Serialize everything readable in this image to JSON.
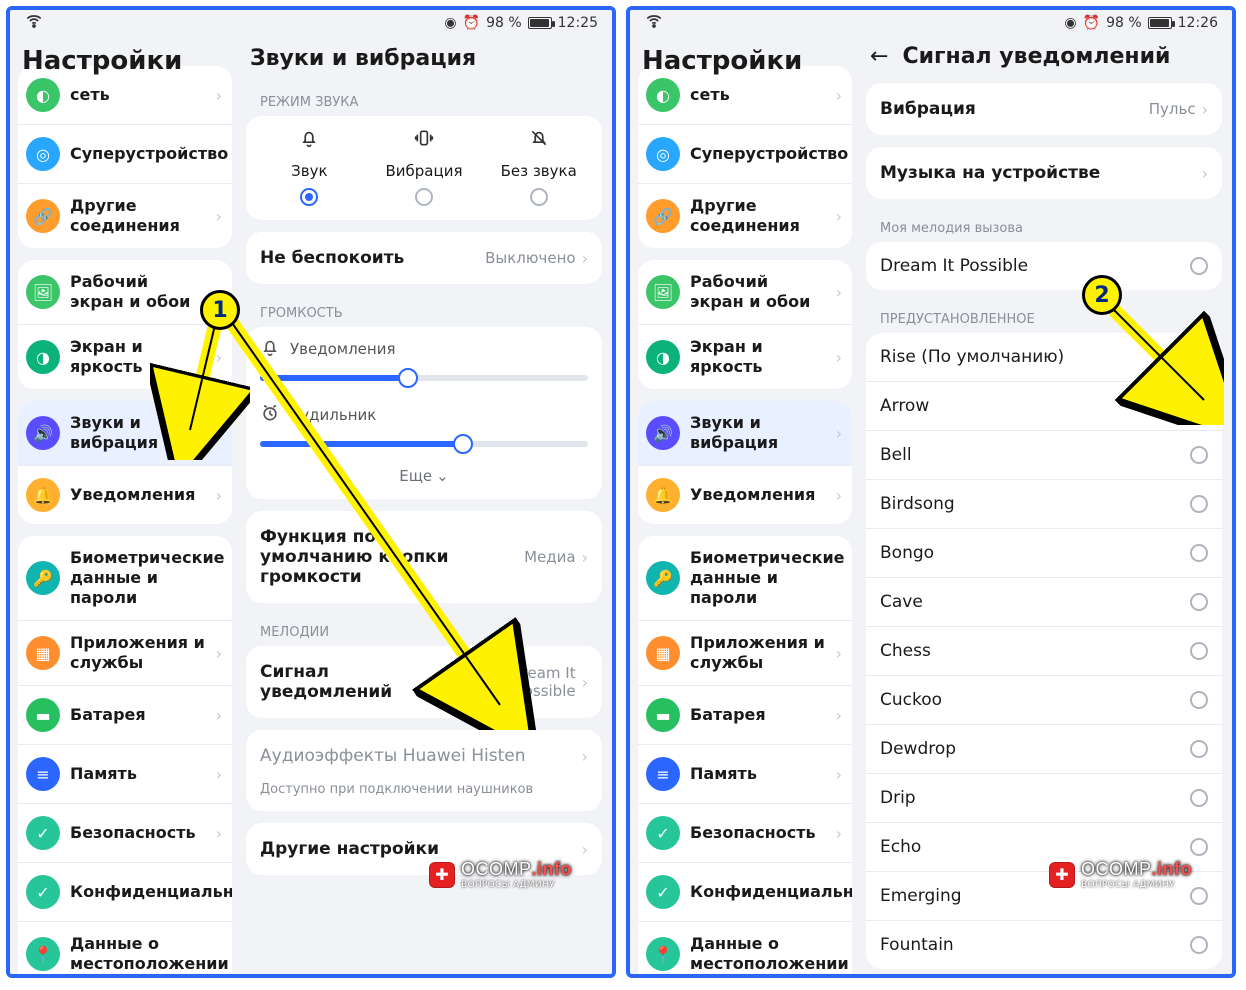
{
  "status": {
    "battery_pct": "98 %",
    "time_left": "12:25",
    "time_right": "12:26"
  },
  "sidebar": {
    "title": "Настройки",
    "groups": [
      [
        {
          "label": "сеть",
          "color": "#3ac569"
        },
        {
          "label": "Суперустройство",
          "color": "#29a7ff"
        },
        {
          "label": "Другие соединения",
          "color": "#ff9c2b"
        }
      ],
      [
        {
          "label": "Рабочий экран и обои",
          "color": "#3ac569"
        },
        {
          "label": "Экран и яркость",
          "color": "#0bb37a"
        }
      ],
      [
        {
          "label": "Звуки и вибрация",
          "color": "#5a4dff",
          "selected": true
        },
        {
          "label": "Уведомления",
          "color": "#ffb02e"
        }
      ],
      [
        {
          "label": "Биометрические данные и пароли",
          "color": "#11b5b0"
        },
        {
          "label": "Приложения и службы",
          "color": "#ff8f2e"
        },
        {
          "label": "Батарея",
          "color": "#27c060"
        },
        {
          "label": "Память",
          "color": "#2a66ff"
        },
        {
          "label": "Безопасность",
          "color": "#26c59a"
        },
        {
          "label": "Конфиденциальность",
          "color": "#26c59a"
        },
        {
          "label": "Данные о местоположении",
          "color": "#26c59a"
        }
      ]
    ]
  },
  "left": {
    "title": "Звуки и вибрация",
    "mode_label": "РЕЖИМ ЗВУКА",
    "modes": [
      {
        "label": "Звук",
        "glyph": "bell",
        "selected": true
      },
      {
        "label": "Вибрация",
        "glyph": "vibrate",
        "selected": false
      },
      {
        "label": "Без звука",
        "glyph": "bell-off",
        "selected": false
      }
    ],
    "dnd": {
      "title": "Не беспокоить",
      "value": "Выключено"
    },
    "volume_label": "ГРОМКОСТЬ",
    "sliders": [
      {
        "icon": "bell",
        "label": "Уведомления",
        "pct": 45
      },
      {
        "icon": "alarm",
        "label": "Будильник",
        "pct": 62
      }
    ],
    "more": "Еще",
    "vol_btn": {
      "title": "Функция по умолчанию кнопки громкости",
      "value": "Медиа"
    },
    "melodies_label": "МЕЛОДИИ",
    "notif": {
      "title": "Сигнал уведомлений",
      "value": "Dream It Possible"
    },
    "histen": {
      "title": "Аудиоэффекты Huawei Histen",
      "hint": "Доступно при подключении наушников"
    },
    "other": "Другие настройки"
  },
  "right": {
    "title": "Сигнал уведомлений",
    "vibration": {
      "title": "Вибрация",
      "value": "Пульс"
    },
    "on_device": "Музыка на устройстве",
    "my_ringtone_label": "Моя мелодия вызова",
    "custom": [
      {
        "name": "Dream It Possible",
        "selected": false
      }
    ],
    "preset_label": "ПРЕДУСТАНОВЛЕННОЕ",
    "preset": [
      {
        "name": "Rise (По умолчанию)",
        "selected": true
      },
      {
        "name": "Arrow"
      },
      {
        "name": "Bell"
      },
      {
        "name": "Birdsong"
      },
      {
        "name": "Bongo"
      },
      {
        "name": "Cave"
      },
      {
        "name": "Chess"
      },
      {
        "name": "Cuckoo"
      },
      {
        "name": "Dewdrop"
      },
      {
        "name": "Drip"
      },
      {
        "name": "Echo"
      },
      {
        "name": "Emerging"
      },
      {
        "name": "Fountain"
      }
    ]
  },
  "annot": {
    "c1": "1",
    "c2": "2"
  },
  "watermark": {
    "brand_a": "OCOMP",
    "brand_b": ".info",
    "sub": "ВОПРОСЫ АДМИНУ"
  }
}
